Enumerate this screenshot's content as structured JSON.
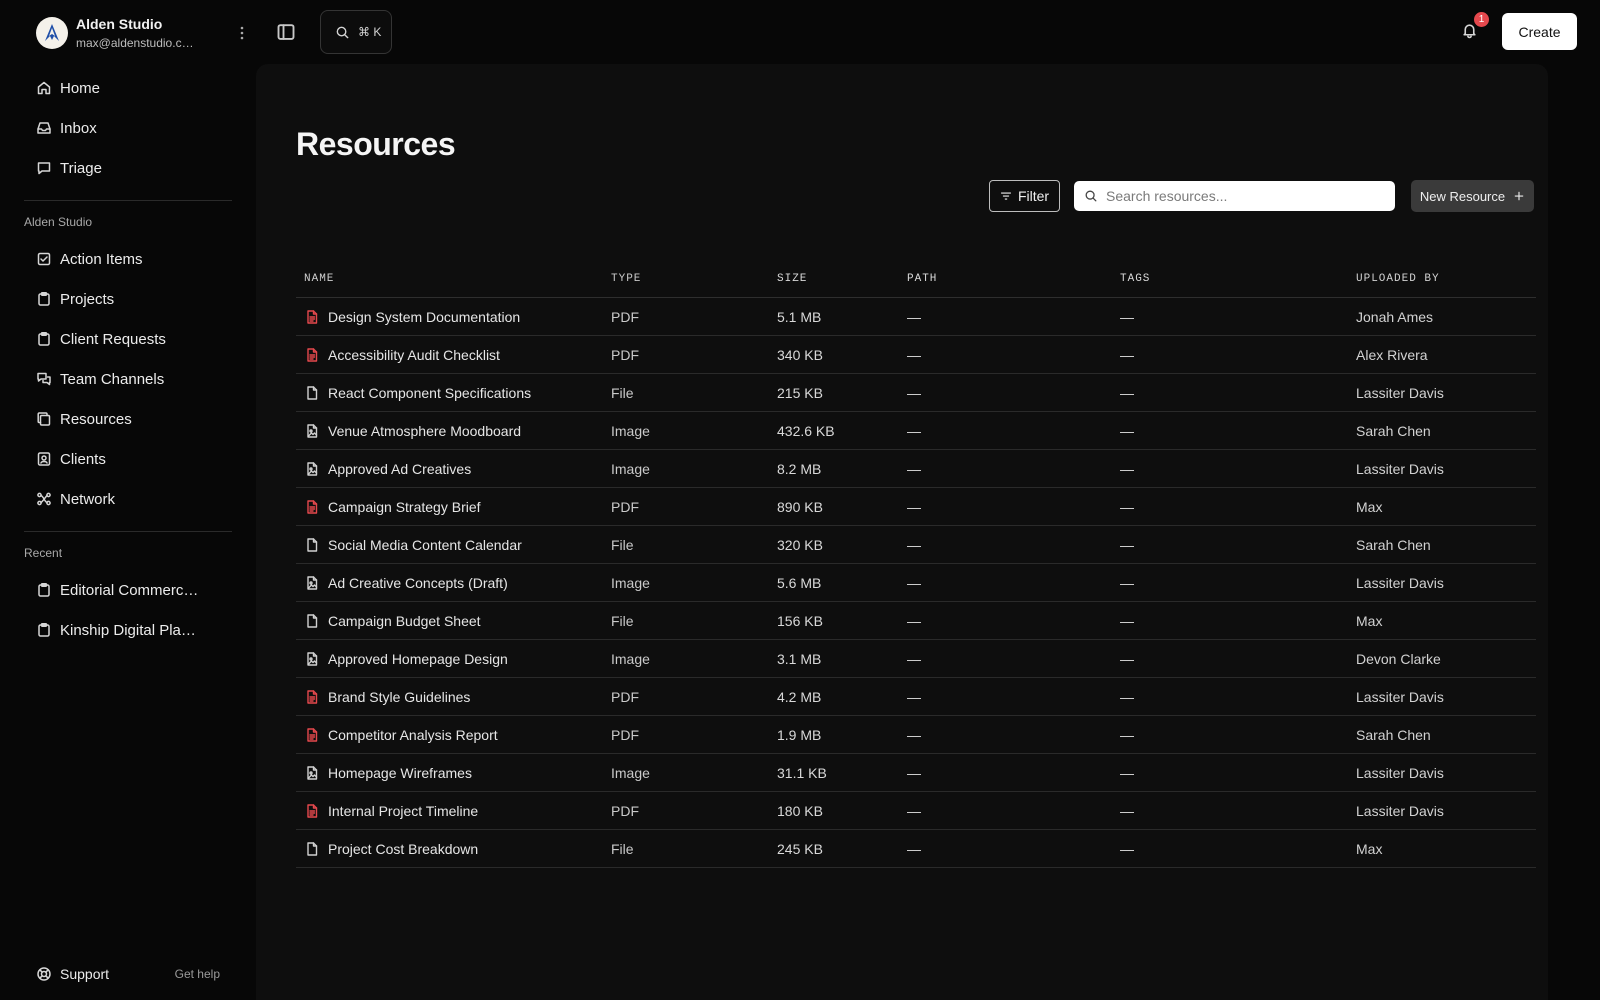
{
  "account": {
    "name": "Alden Studio",
    "email": "max@aldenstudio.com"
  },
  "nav_primary": [
    {
      "label": "Home",
      "icon": "home-icon"
    },
    {
      "label": "Inbox",
      "icon": "inbox-icon"
    },
    {
      "label": "Triage",
      "icon": "chat-icon"
    }
  ],
  "workspace_label": "Alden Studio",
  "nav_workspace": [
    {
      "label": "Action Items",
      "icon": "checklist-icon"
    },
    {
      "label": "Projects",
      "icon": "clipboard-icon"
    },
    {
      "label": "Client Requests",
      "icon": "clipboard-icon"
    },
    {
      "label": "Team Channels",
      "icon": "chat-bubbles-icon"
    },
    {
      "label": "Resources",
      "icon": "copy-icon"
    },
    {
      "label": "Clients",
      "icon": "contact-icon"
    },
    {
      "label": "Network",
      "icon": "network-icon"
    }
  ],
  "recent_label": "Recent",
  "nav_recent": [
    {
      "label": "Editorial Commerce Redesign",
      "icon": "clipboard-icon"
    },
    {
      "label": "Kinship Digital Platform",
      "icon": "clipboard-icon"
    }
  ],
  "support": {
    "label": "Support",
    "help": "Get help"
  },
  "topbar": {
    "shortcut": "⌘ K",
    "notification_count": "1",
    "create_label": "Create"
  },
  "page": {
    "title": "Resources",
    "filter_label": "Filter",
    "search_placeholder": "Search resources...",
    "new_label": "New Resource",
    "columns": [
      "NAME",
      "TYPE",
      "SIZE",
      "PATH",
      "TAGS",
      "UPLOADED BY"
    ],
    "rows": [
      {
        "name": "Design System Documentation",
        "type": "PDF",
        "size": "5.1 MB",
        "path": "—",
        "tags": "—",
        "uploaded_by": "Jonah Ames"
      },
      {
        "name": "Accessibility Audit Checklist",
        "type": "PDF",
        "size": "340 KB",
        "path": "—",
        "tags": "—",
        "uploaded_by": "Alex Rivera"
      },
      {
        "name": "React Component Specifications",
        "type": "File",
        "size": "215 KB",
        "path": "—",
        "tags": "—",
        "uploaded_by": "Lassiter Davis"
      },
      {
        "name": "Venue Atmosphere Moodboard",
        "type": "Image",
        "size": "432.6 KB",
        "path": "—",
        "tags": "—",
        "uploaded_by": "Sarah Chen"
      },
      {
        "name": "Approved Ad Creatives",
        "type": "Image",
        "size": "8.2 MB",
        "path": "—",
        "tags": "—",
        "uploaded_by": "Lassiter Davis"
      },
      {
        "name": "Campaign Strategy Brief",
        "type": "PDF",
        "size": "890 KB",
        "path": "—",
        "tags": "—",
        "uploaded_by": "Max"
      },
      {
        "name": "Social Media Content Calendar",
        "type": "File",
        "size": "320 KB",
        "path": "—",
        "tags": "—",
        "uploaded_by": "Sarah Chen"
      },
      {
        "name": "Ad Creative Concepts (Draft)",
        "type": "Image",
        "size": "5.6 MB",
        "path": "—",
        "tags": "—",
        "uploaded_by": "Lassiter Davis"
      },
      {
        "name": "Campaign Budget Sheet",
        "type": "File",
        "size": "156 KB",
        "path": "—",
        "tags": "—",
        "uploaded_by": "Max"
      },
      {
        "name": "Approved Homepage Design",
        "type": "Image",
        "size": "3.1 MB",
        "path": "—",
        "tags": "—",
        "uploaded_by": "Devon Clarke"
      },
      {
        "name": "Brand Style Guidelines",
        "type": "PDF",
        "size": "4.2 MB",
        "path": "—",
        "tags": "—",
        "uploaded_by": "Lassiter Davis"
      },
      {
        "name": "Competitor Analysis Report",
        "type": "PDF",
        "size": "1.9 MB",
        "path": "—",
        "tags": "—",
        "uploaded_by": "Sarah Chen"
      },
      {
        "name": "Homepage Wireframes",
        "type": "Image",
        "size": "31.1 KB",
        "path": "—",
        "tags": "—",
        "uploaded_by": "Lassiter Davis"
      },
      {
        "name": "Internal Project Timeline",
        "type": "PDF",
        "size": "180 KB",
        "path": "—",
        "tags": "—",
        "uploaded_by": "Lassiter Davis"
      },
      {
        "name": "Project Cost Breakdown",
        "type": "File",
        "size": "245 KB",
        "path": "—",
        "tags": "—",
        "uploaded_by": "Max"
      }
    ]
  },
  "colors": {
    "pdf_icon": "#e5484d",
    "file_icon": "#d0d0d0",
    "image_icon": "#d0d0d0",
    "notification_badge": "#e5484d"
  }
}
